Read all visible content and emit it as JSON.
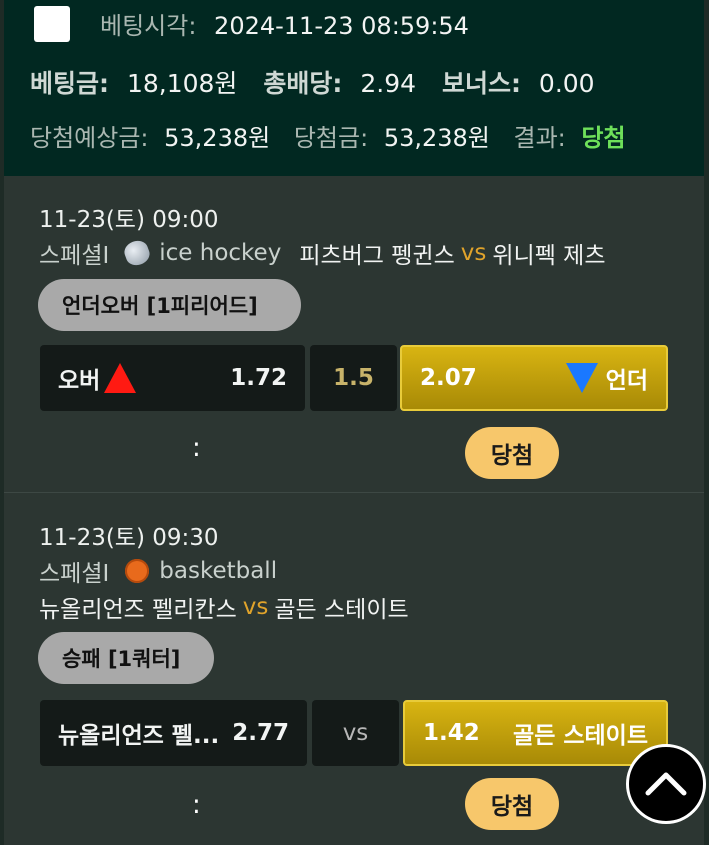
{
  "summary": {
    "bet_time_label": "베팅시각:",
    "bet_time": "2024-11-23 08:59:54",
    "stake_label": "베팅금:",
    "stake": "18,108원",
    "total_odds_label": "총배당:",
    "total_odds": "2.94",
    "bonus_label": "보너스:",
    "bonus": "0.00",
    "expected_label": "당첨예상금:",
    "expected": "53,238원",
    "win_amount_label": "당첨금:",
    "win_amount": "53,238원",
    "result_label": "결과:",
    "result": "당첨",
    "result_color": "#6ee05a"
  },
  "bets": [
    {
      "datetime": "11-23(토) 09:00",
      "league": "스페셜I",
      "sport": "ice hockey",
      "sport_icon": "hockey-puck-icon",
      "home": "피츠버그 펭귄스",
      "vs": "vs",
      "away": "위니펙 제츠",
      "market": "언더오버 [1피리어드]",
      "left": {
        "label": "오버",
        "odds": "1.72",
        "indicator": "up-triangle-icon"
      },
      "middle": "1.5",
      "right": {
        "label": "언더",
        "odds": "2.07",
        "indicator": "down-triangle-icon"
      },
      "selected": "right",
      "score": ":",
      "status": "당첨"
    },
    {
      "datetime": "11-23(토) 09:30",
      "league": "스페셜I",
      "sport": "basketball",
      "sport_icon": "basketball-icon",
      "home": "뉴올리언즈 펠리칸스",
      "vs": "vs",
      "away": "골든 스테이트",
      "market": "승패 [1쿼터]",
      "left": {
        "label": "뉴올리언즈 펠...",
        "odds": "2.77"
      },
      "middle": "vs",
      "right": {
        "label": "골든 스테이트",
        "odds": "1.42"
      },
      "selected": "right",
      "score": ":",
      "status": "당첨"
    }
  ],
  "colors": {
    "gold": "#d8b412",
    "vs": "#e0a32b",
    "status_pill": "#f7c76b"
  }
}
